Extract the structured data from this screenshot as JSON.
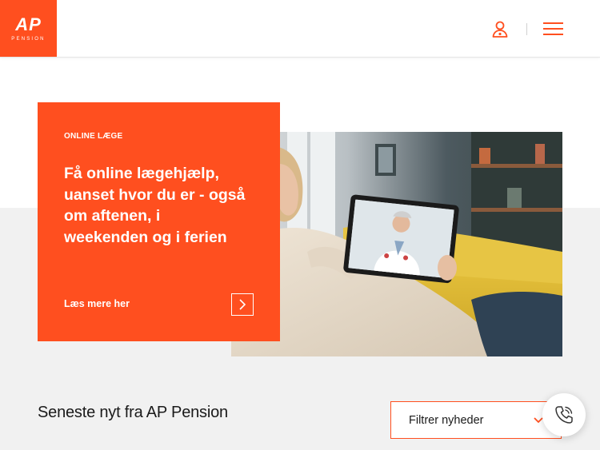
{
  "header": {
    "logo_text": "AP",
    "logo_subtext": "PENSION",
    "user_icon": "user-icon",
    "menu_icon": "hamburger-menu-icon"
  },
  "promo": {
    "eyebrow": "ONLINE LÆGE",
    "heading": "Få online lægehjælp, uanset hvor du er - også om aftenen, i weekenden og i ferien",
    "link_label": "Læs mere her",
    "arrow_icon": "chevron-right-icon",
    "image_icon": "video-call-photo"
  },
  "news": {
    "title": "Seneste nyt fra AP Pension",
    "filter_label": "Filtrer nyheder",
    "filter_icon": "chevron-down-icon"
  },
  "call_button": {
    "icon": "phone-call-icon"
  },
  "colors": {
    "brand": "#ff4f1f",
    "band": "#f1f1f1",
    "text": "#1a1a1a"
  }
}
